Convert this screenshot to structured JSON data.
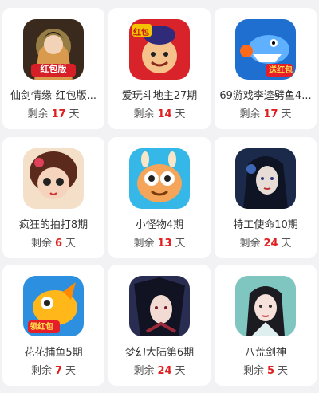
{
  "games": [
    {
      "title": "仙剑情缘-红包版...",
      "remain_prefix": "剩余",
      "days": "17",
      "remain_suffix": "天",
      "badge": "红包版",
      "accent": "#c8902a"
    },
    {
      "title": "爱玩斗地主27期",
      "remain_prefix": "剩余",
      "days": "14",
      "remain_suffix": "天",
      "badge": "红包",
      "accent": "#d8232a"
    },
    {
      "title": "69游戏李逵劈鱼4...",
      "remain_prefix": "剩余",
      "days": "17",
      "remain_suffix": "天",
      "badge": "送红包",
      "accent": "#1f6fd1"
    },
    {
      "title": "疯狂的拍打8期",
      "remain_prefix": "剩余",
      "days": "6",
      "remain_suffix": "天",
      "badge": "",
      "accent": "#e9b08a"
    },
    {
      "title": "小怪物4期",
      "remain_prefix": "剩余",
      "days": "13",
      "remain_suffix": "天",
      "badge": "",
      "accent": "#35b7e8"
    },
    {
      "title": "特工使命10期",
      "remain_prefix": "剩余",
      "days": "24",
      "remain_suffix": "天",
      "badge": "",
      "accent": "#1b2a4a"
    },
    {
      "title": "花花捕鱼5期",
      "remain_prefix": "剩余",
      "days": "7",
      "remain_suffix": "天",
      "badge": "领红包",
      "accent": "#2d8fe0"
    },
    {
      "title": "梦幻大陆第6期",
      "remain_prefix": "剩余",
      "days": "24",
      "remain_suffix": "天",
      "badge": "",
      "accent": "#2a2d52"
    },
    {
      "title": "八荒剑神",
      "remain_prefix": "剩余",
      "days": "5",
      "remain_suffix": "天",
      "badge": "",
      "accent": "#7fc6c0"
    }
  ]
}
